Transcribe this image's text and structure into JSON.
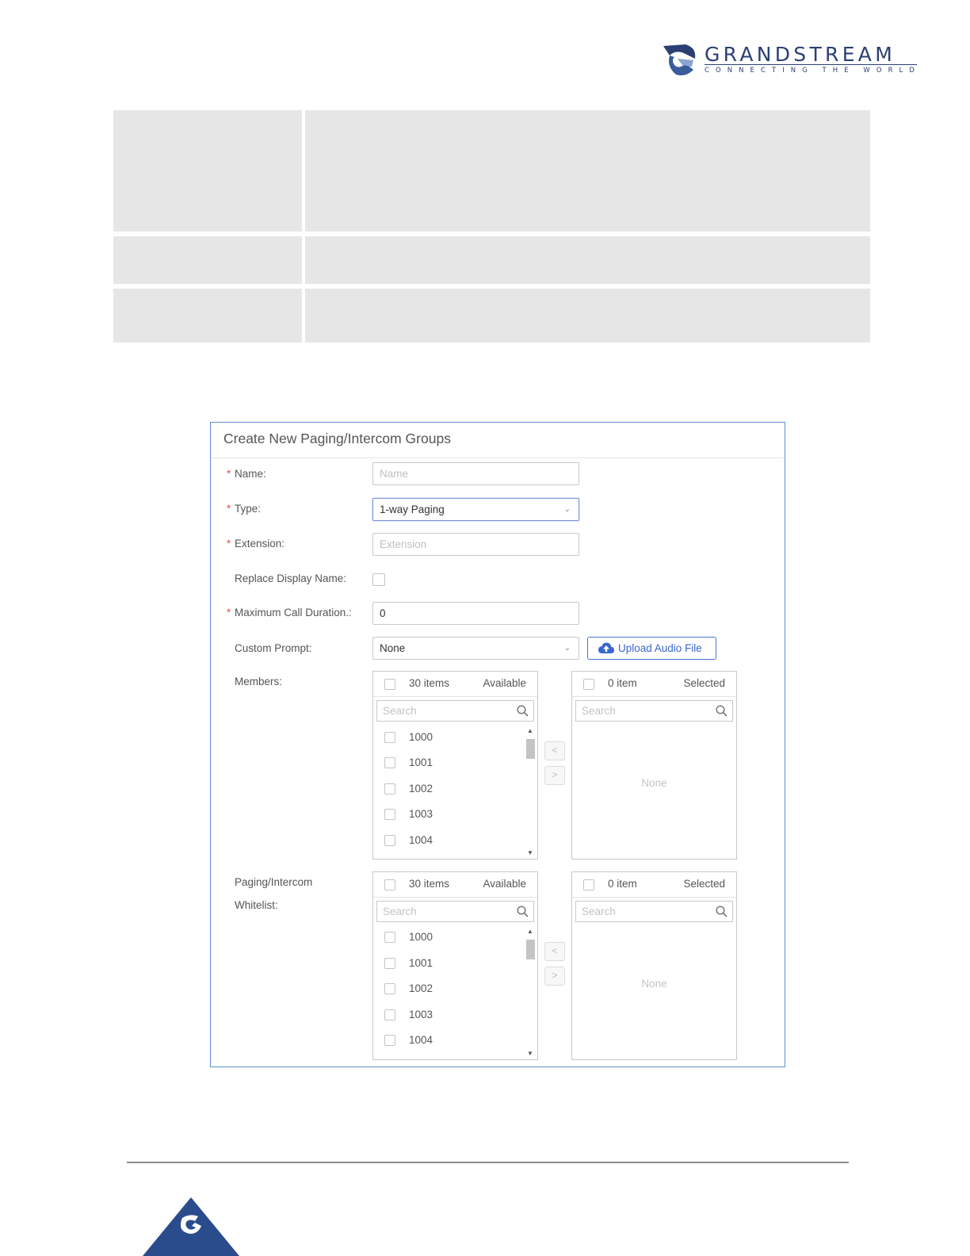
{
  "brand": {
    "name": "GRANDSTREAM",
    "tagline": "CONNECTING THE WORLD",
    "color": "#2b3f73"
  },
  "form": {
    "title": "Create New Paging/Intercom Groups",
    "name": {
      "label": "Name:",
      "placeholder": "Name",
      "value": ""
    },
    "type": {
      "label": "Type:",
      "value": "1-way Paging"
    },
    "extension": {
      "label": "Extension:",
      "placeholder": "Extension",
      "value": ""
    },
    "replace_display_name": {
      "label": "Replace Display Name:",
      "checked": false
    },
    "max_call_duration": {
      "label": "Maximum Call Duration.:",
      "value": "0"
    },
    "custom_prompt": {
      "label": "Custom Prompt:",
      "value": "None"
    },
    "upload_button": "Upload Audio File",
    "members": {
      "label": "Members:",
      "available": {
        "count": "30 items",
        "title": "Available",
        "search_placeholder": "Search",
        "items": [
          "1000",
          "1001",
          "1002",
          "1003",
          "1004"
        ]
      },
      "selected": {
        "count": "0 item",
        "title": "Selected",
        "search_placeholder": "Search",
        "empty_text": "None"
      }
    },
    "whitelist": {
      "label_line1": "Paging/Intercom",
      "label_line2": "Whitelist:",
      "available": {
        "count": "30 items",
        "title": "Available",
        "search_placeholder": "Search",
        "items": [
          "1000",
          "1001",
          "1002",
          "1003",
          "1004"
        ]
      },
      "selected": {
        "count": "0 item",
        "title": "Selected",
        "search_placeholder": "Search",
        "empty_text": "None"
      }
    },
    "required_mark": "*",
    "move_left": "<",
    "move_right": ">"
  },
  "colors": {
    "accent": "#3b66d0",
    "required": "#e5534b",
    "panel_border": "#5b8fd0",
    "table_fill": "#e6e6e6"
  },
  "icons": [
    "grandstream-logo-icon",
    "chevron-down-icon",
    "cloud-upload-icon",
    "search-icon",
    "scroll-up-icon",
    "scroll-down-icon"
  ]
}
